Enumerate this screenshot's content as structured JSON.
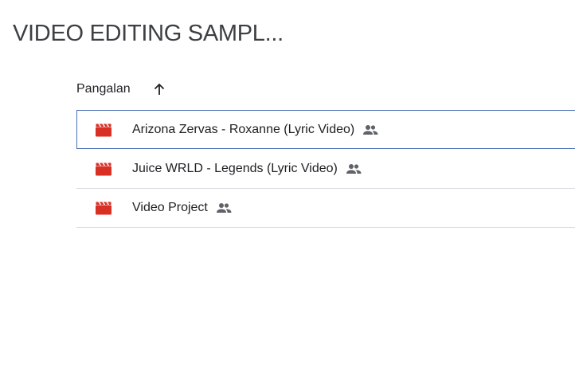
{
  "page": {
    "title": "VIDEO EDITING SAMPL..."
  },
  "list_header": {
    "column_label": "Pangalan",
    "sort_icon": "arrow-upward-icon"
  },
  "files": [
    {
      "name": "Arizona Zervas - Roxanne (Lyric Video)",
      "icon": "video-clapperboard-icon",
      "shared_icon": "shared-people-icon",
      "selected": true
    },
    {
      "name": "Juice WRLD - Legends (Lyric Video)",
      "icon": "video-clapperboard-icon",
      "shared_icon": "shared-people-icon",
      "selected": false
    },
    {
      "name": "Video Project",
      "icon": "video-clapperboard-icon",
      "shared_icon": "shared-people-icon",
      "selected": false
    }
  ],
  "colors": {
    "video_icon": "#d93025",
    "selection_border": "#4a6fb5",
    "divider": "#dadce0",
    "shared_icon": "#5f6368"
  }
}
